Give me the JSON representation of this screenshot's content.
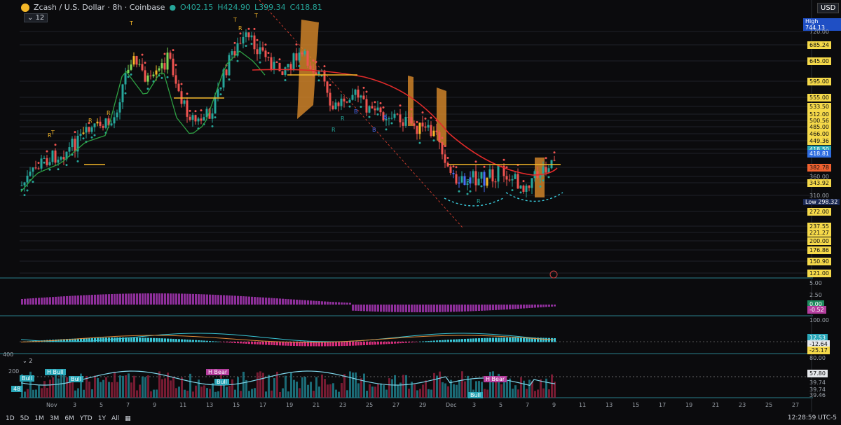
{
  "header": {
    "symbol": "Zcash / U.S. Dollar · 8h · Coinbase",
    "open": "O402.15",
    "high": "H424.90",
    "low": "L399.34",
    "close": "C418.81",
    "indicator_count": "12",
    "currency": "USD"
  },
  "price_axis": {
    "high_label": "High",
    "high_value": "744.13",
    "low_label": "Low",
    "low_value": "298.32",
    "levels": [
      "720.00",
      "685.24",
      "645.00",
      "595.00",
      "555.00",
      "533.50",
      "512.00",
      "500.56",
      "485.00",
      "466.00",
      "449.36",
      "418.50",
      "418.81",
      "382.78",
      "360.00",
      "343.92",
      "310.00",
      "272.00",
      "237.55",
      "221.27",
      "200.00",
      "176.86",
      "150.90",
      "121.00"
    ]
  },
  "osc1": {
    "levels": [
      "5.00",
      "2.50",
      "0.00",
      "-0.52"
    ]
  },
  "osc2": {
    "levels": [
      "100.00",
      "12.53",
      "-12.64",
      "-25.17"
    ]
  },
  "osc3": {
    "levels": [
      "400",
      "200",
      "80.00",
      "57.80",
      "39.74",
      "39.74",
      "39.46"
    ],
    "tags": [
      "Bull",
      "H Bull",
      "Bull",
      "H Bear",
      "Bull",
      "H Bear",
      "Bull",
      "48"
    ],
    "count": "2"
  },
  "signals": {
    "t": "T",
    "r": "R",
    "b": "B"
  },
  "x_axis": [
    "Nov",
    "3",
    "5",
    "7",
    "9",
    "11",
    "13",
    "15",
    "17",
    "19",
    "21",
    "23",
    "25",
    "27",
    "29",
    "Dec",
    "3",
    "5",
    "7",
    "9",
    "11",
    "13",
    "15",
    "17",
    "19",
    "21",
    "23",
    "25",
    "27"
  ],
  "timeframes": [
    "1D",
    "5D",
    "1M",
    "3M",
    "6M",
    "YTD",
    "1Y",
    "All"
  ],
  "clock": "12:28:59 UTC-5",
  "colors": {
    "up": "#26a69a",
    "down": "#ef5350",
    "accent": "#f4b728",
    "cyan": "#39c6d6",
    "magenta": "#b43d9d"
  }
}
